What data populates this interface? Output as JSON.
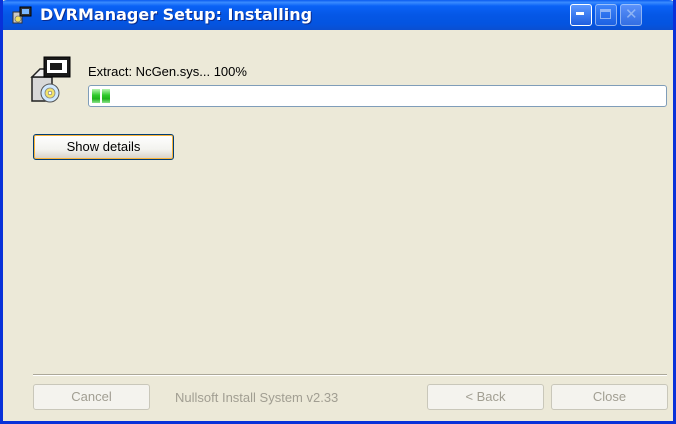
{
  "window": {
    "title": "DVRManager Setup: Installing",
    "icon": "installer-icon",
    "controls": {
      "minimize": "minimize-icon",
      "maximize": "maximize-icon",
      "close": "close-icon",
      "close_glyph": "✕"
    }
  },
  "install": {
    "status": "Extract: NcGen.sys... 100%",
    "progress_fraction": 0.02,
    "icon": "install-package-icon"
  },
  "buttons": {
    "show_details": "Show details",
    "cancel": "Cancel",
    "back": "< Back",
    "close": "Close"
  },
  "footer": {
    "branding": "Nullsoft Install System v2.33"
  },
  "colors": {
    "titlebar": "#0454e0",
    "window_bg": "#ece9d8",
    "progress_green": "#2ec92a"
  }
}
